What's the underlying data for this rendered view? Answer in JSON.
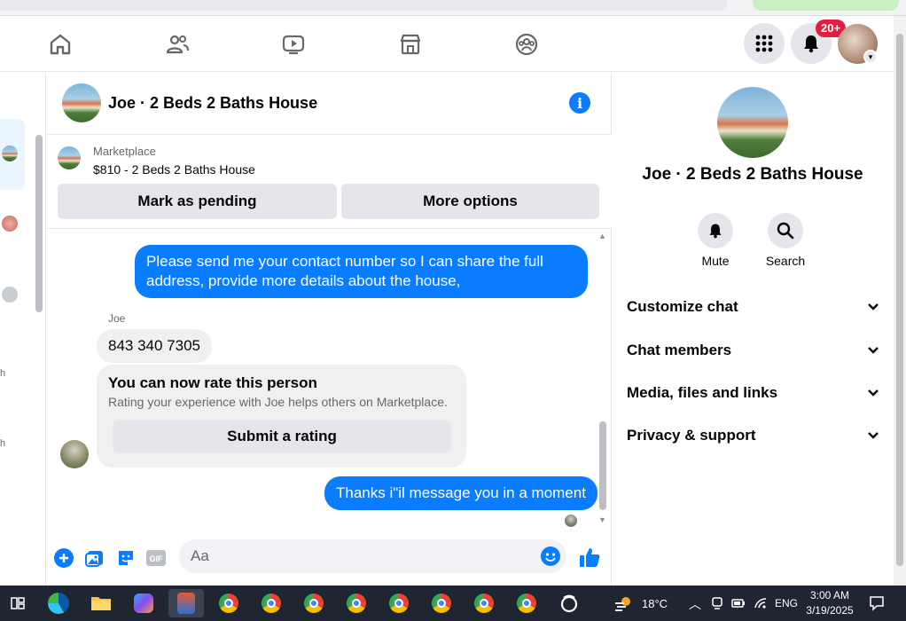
{
  "topnav": {
    "notif_badge": "20+",
    "icons": [
      "home-icon",
      "friends-icon",
      "watch-icon",
      "marketplace-icon",
      "groups-icon",
      "menu-grid-icon",
      "bell-icon"
    ]
  },
  "chat": {
    "title": "Joe · 2 Beds 2 Baths House",
    "marketplace": {
      "label": "Marketplace",
      "listing": "$810 - 2 Beds 2 Baths House",
      "mark_pending": "Mark as pending",
      "more_options": "More options"
    },
    "messages": {
      "out1": "Please send me your contact number so I can share the full address, provide more details about the house,",
      "sender": "Joe",
      "in1": "843 340 7305",
      "rate_title": "You can now rate this person",
      "rate_sub": "Rating your experience with Joe helps others on Marketplace.",
      "rate_button": "Submit a rating",
      "out2": "Thanks i\"il message you in a moment"
    },
    "composer": {
      "placeholder": "Aa",
      "gif_label": "GIF"
    }
  },
  "right_panel": {
    "name": "Joe · 2 Beds 2 Baths House",
    "actions": {
      "mute": "Mute",
      "search": "Search"
    },
    "rows": {
      "customize": "Customize chat",
      "members": "Chat members",
      "media": "Media, files and links",
      "privacy": "Privacy & support"
    }
  },
  "taskbar": {
    "weather": "18°C",
    "lang": "ENG",
    "time": "3:00 AM",
    "date": "3/19/2025"
  },
  "colors": {
    "messenger_blue": "#0a7cff",
    "bubble_gray": "#f0f0f0",
    "badge_red": "#e41e3f"
  }
}
